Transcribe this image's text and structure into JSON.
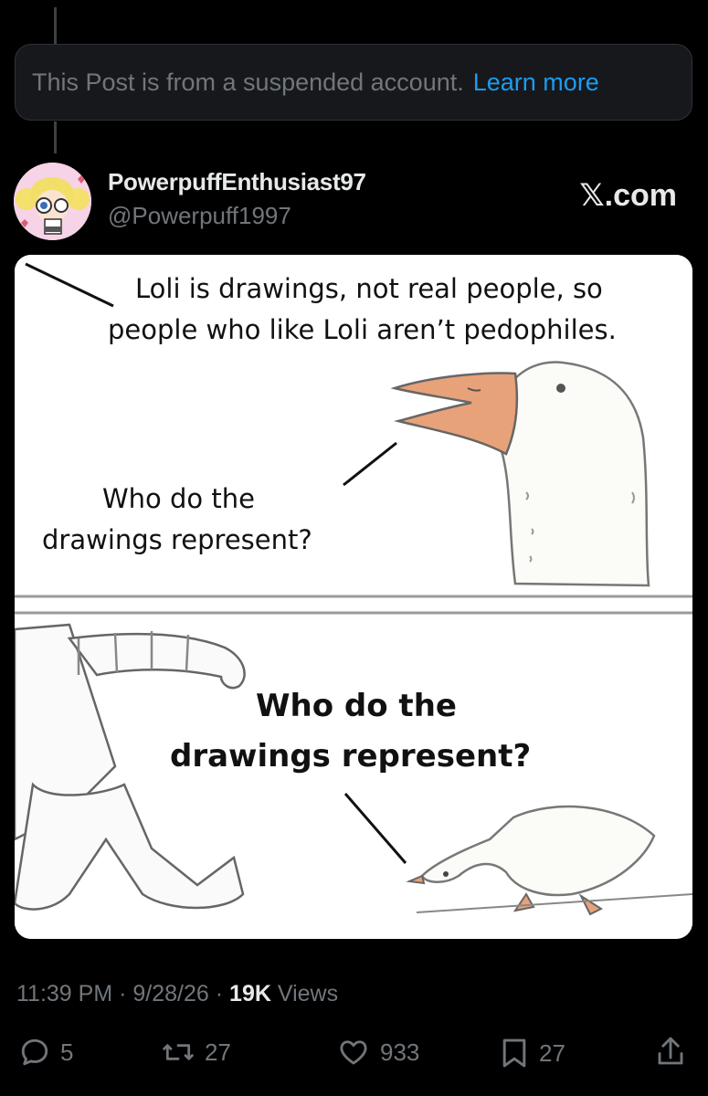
{
  "notice": {
    "text": "This Post is from a suspended account.",
    "link": "Learn more"
  },
  "post": {
    "author_name": "PowerpuffEnthusiast97",
    "author_handle": "@Powerpuff1997",
    "brand": "𝕏.com",
    "meme": {
      "top_caption_line1": "Loli is drawings, not real people, so",
      "top_caption_line2": "people who like Loli aren’t pedophiles.",
      "goose_question_line1": "Who do the",
      "goose_question_line2": "drawings represent?",
      "bottom_question_line1": "Who do the",
      "bottom_question_line2": "drawings represent?"
    },
    "time": "11:39 PM",
    "date": "9/28/26",
    "views_count": "19K",
    "views_label": "Views",
    "sep": "·"
  },
  "actions": {
    "replies": "5",
    "reposts": "27",
    "likes": "933",
    "bookmarks": "27"
  },
  "colors": {
    "background": "#000000",
    "accent_link": "#1d9bf0",
    "muted": "#71767b",
    "notice_bg": "#16181c"
  }
}
